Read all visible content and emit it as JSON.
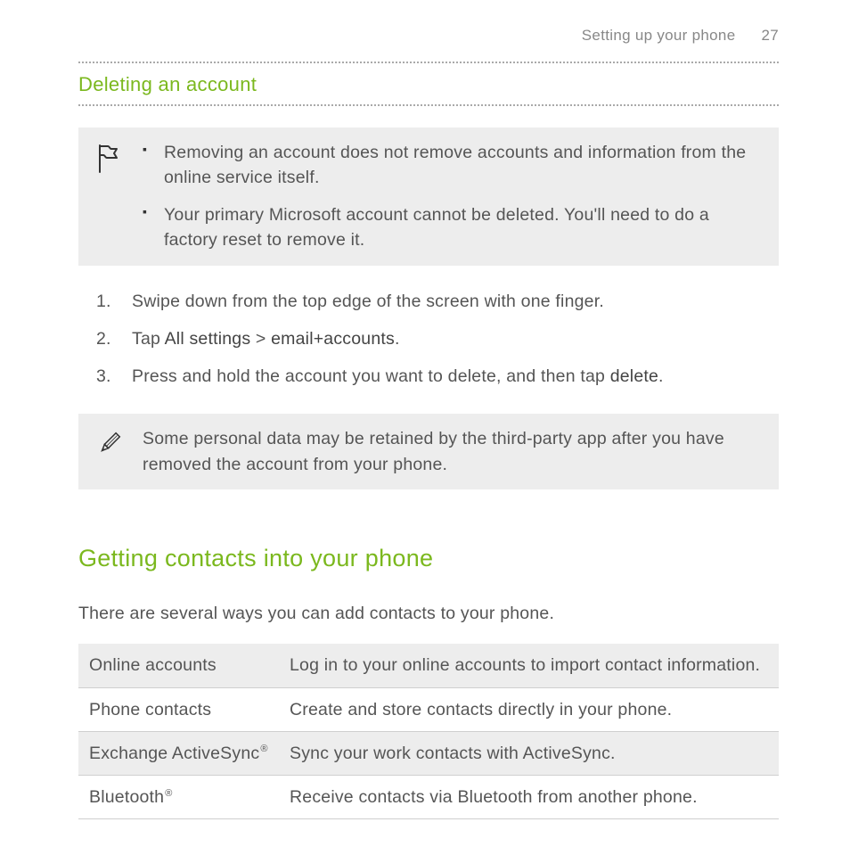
{
  "header": {
    "title": "Setting up your phone",
    "page_number": "27"
  },
  "section1": {
    "heading": "Deleting an account",
    "callout1": {
      "items": [
        "Removing an account does not remove accounts and information from the online service itself.",
        "Your primary Microsoft account cannot be deleted. You'll need to do a factory reset to remove it."
      ]
    },
    "steps": [
      {
        "text": "Swipe down from the top edge of the screen with one finger."
      },
      {
        "prefix": "Tap ",
        "bold1": "All settings",
        "mid": " > ",
        "bold2": "email+accounts",
        "suffix": "."
      },
      {
        "prefix": "Press and hold the account you want to delete, and then tap ",
        "bold1": "delete",
        "suffix": "."
      }
    ],
    "callout2": {
      "text": "Some personal data may be retained by the third-party app after you have removed the account from your phone."
    }
  },
  "section2": {
    "heading": "Getting contacts into your phone",
    "intro": "There are several ways you can add contacts to your phone.",
    "table": [
      {
        "label": "Online accounts",
        "reg": "",
        "desc": "Log in to your online accounts to import contact information."
      },
      {
        "label": "Phone contacts",
        "reg": "",
        "desc": "Create and store contacts directly in your phone."
      },
      {
        "label": "Exchange ActiveSync",
        "reg": "®",
        "desc": "Sync your work contacts with ActiveSync."
      },
      {
        "label": "Bluetooth",
        "reg": "®",
        "desc": "Receive contacts via Bluetooth from another phone."
      }
    ]
  }
}
